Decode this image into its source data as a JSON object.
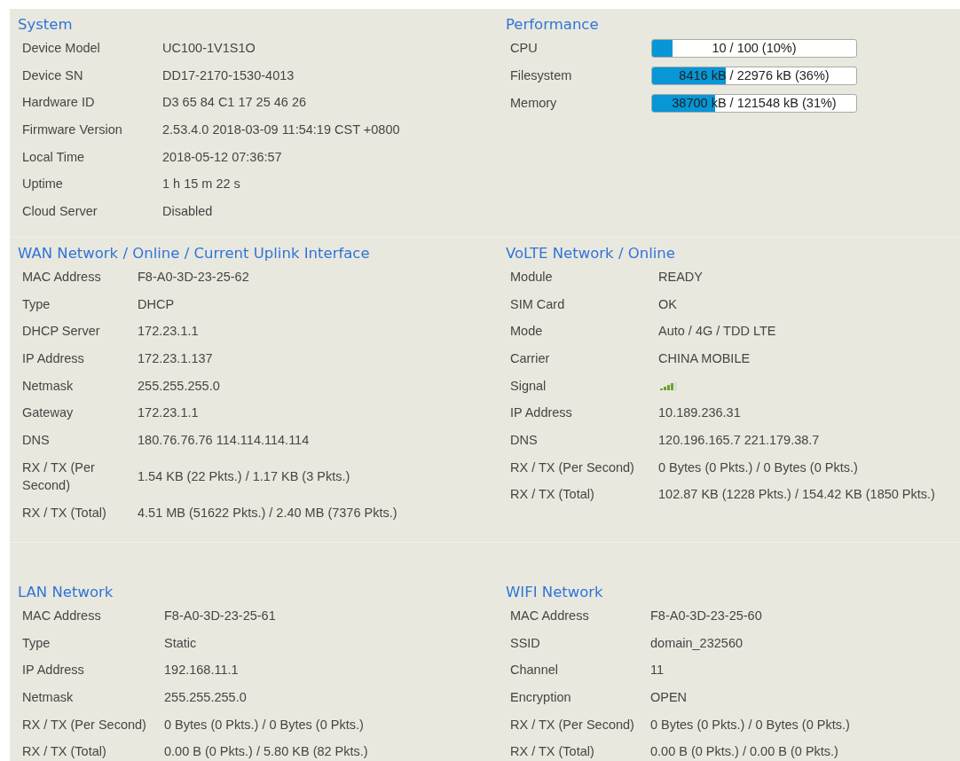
{
  "sections": [
    {
      "title": "System",
      "rows": [
        {
          "kind": "text",
          "label": "Device Model",
          "value": "UC100-1V1S1O"
        },
        {
          "kind": "text",
          "label": "Device SN",
          "value": "DD17-2170-1530-4013"
        },
        {
          "kind": "text",
          "label": "Hardware ID",
          "value": "D3 65 84 C1 17 25 46 26"
        },
        {
          "kind": "text",
          "label": "Firmware Version",
          "value": "2.53.4.0 2018-03-09 11:54:19 CST +0800"
        },
        {
          "kind": "text",
          "label": "Local Time",
          "value": "2018-05-12 07:36:57"
        },
        {
          "kind": "text",
          "label": "Uptime",
          "value": "1 h 15 m 22 s"
        },
        {
          "kind": "text",
          "label": "Cloud Server",
          "value": "Disabled"
        }
      ]
    },
    {
      "title": "Performance",
      "rows": [
        {
          "kind": "meter",
          "label": "CPU",
          "value": "10 / 100 (10%)",
          "level": 0.1
        },
        {
          "kind": "meter",
          "label": "Filesystem",
          "value": "8416 kB / 22976 kB (36%)",
          "level": 0.36
        },
        {
          "kind": "meter",
          "label": "Memory",
          "value": "38700 kB / 121548 kB (31%)",
          "level": 0.31
        }
      ]
    },
    {
      "title": "WAN Network / Online / Current Uplink Interface",
      "rows": [
        {
          "kind": "text",
          "label": "MAC Address",
          "value": "F8-A0-3D-23-25-62"
        },
        {
          "kind": "text",
          "label": "Type",
          "value": "DHCP"
        },
        {
          "kind": "text",
          "label": "DHCP Server",
          "value": "172.23.1.1"
        },
        {
          "kind": "text",
          "label": "IP Address",
          "value": "172.23.1.137"
        },
        {
          "kind": "text",
          "label": "Netmask",
          "value": "255.255.255.0"
        },
        {
          "kind": "text",
          "label": "Gateway",
          "value": "172.23.1.1"
        },
        {
          "kind": "text",
          "label": "DNS",
          "value": "180.76.76.76 114.114.114.114"
        },
        {
          "kind": "text",
          "label": "RX / TX (Per Second)",
          "value": "1.54 KB (22 Pkts.) / 1.17 KB (3 Pkts.)"
        },
        {
          "kind": "text",
          "label": "RX / TX (Total)",
          "value": "4.51 MB (51622 Pkts.) / 2.40 MB (7376 Pkts.)"
        }
      ]
    },
    {
      "title": "VoLTE Network / Online",
      "rows": [
        {
          "kind": "text",
          "label": "Module",
          "value": "READY"
        },
        {
          "kind": "text",
          "label": "SIM Card",
          "value": "OK"
        },
        {
          "kind": "text",
          "label": "Mode",
          "value": "Auto / 4G / TDD LTE"
        },
        {
          "kind": "text",
          "label": "Carrier",
          "value": "CHINA MOBILE"
        },
        {
          "kind": "signal",
          "label": "Signal"
        },
        {
          "kind": "text",
          "label": "IP Address",
          "value": "10.189.236.31"
        },
        {
          "kind": "text",
          "label": "DNS",
          "value": "120.196.165.7 221.179.38.7"
        },
        {
          "kind": "text",
          "label": "RX / TX (Per Second)",
          "value": "0 Bytes (0 Pkts.) / 0 Bytes (0 Pkts.)"
        },
        {
          "kind": "text",
          "label": "RX / TX (Total)",
          "value": "102.87 KB (1228 Pkts.) / 154.42 KB (1850 Pkts.)"
        }
      ]
    },
    {
      "title": "LAN Network",
      "rows": [
        {
          "kind": "text",
          "label": "MAC Address",
          "value": "F8-A0-3D-23-25-61"
        },
        {
          "kind": "text",
          "label": "Type",
          "value": "Static"
        },
        {
          "kind": "text",
          "label": "IP Address",
          "value": "192.168.11.1"
        },
        {
          "kind": "text",
          "label": "Netmask",
          "value": "255.255.255.0"
        },
        {
          "kind": "text",
          "label": "RX / TX (Per Second)",
          "value": "0 Bytes (0 Pkts.) / 0 Bytes (0 Pkts.)"
        },
        {
          "kind": "text",
          "label": "RX / TX (Total)",
          "value": "0.00 B (0 Pkts.) / 5.80 KB (82 Pkts.)"
        }
      ]
    },
    {
      "title": "WIFI Network",
      "rows": [
        {
          "kind": "text",
          "label": "MAC Address",
          "value": "F8-A0-3D-23-25-60"
        },
        {
          "kind": "text",
          "label": "SSID",
          "value": "domain_232560"
        },
        {
          "kind": "text",
          "label": "Channel",
          "value": "11"
        },
        {
          "kind": "text",
          "label": "Encryption",
          "value": "OPEN"
        },
        {
          "kind": "text",
          "label": "RX / TX (Per Second)",
          "value": "0 Bytes (0 Pkts.) / 0 Bytes (0 Pkts.)"
        },
        {
          "kind": "text",
          "label": "RX / TX (Total)",
          "value": "0.00 B (0 Pkts.) / 0.00 B (0 Pkts.)"
        }
      ]
    }
  ]
}
